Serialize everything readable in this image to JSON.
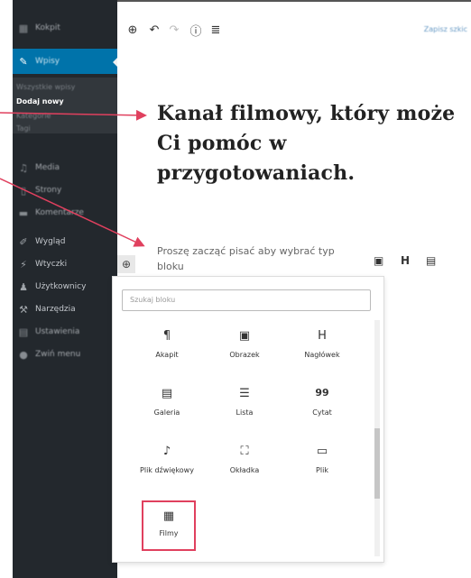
{
  "sidebar": {
    "items": [
      {
        "label": "Kokpit",
        "icon": "dashboard-icon"
      },
      {
        "label": "Wpisy",
        "icon": "pin-icon"
      },
      {
        "label": "Media",
        "icon": "media-icon"
      },
      {
        "label": "Strony",
        "icon": "page-icon"
      },
      {
        "label": "Komentarze",
        "icon": "comment-icon"
      },
      {
        "label": "Wygląd",
        "icon": "brush-icon"
      },
      {
        "label": "Wtyczki",
        "icon": "plugin-icon"
      },
      {
        "label": "Użytkownicy",
        "icon": "users-icon"
      },
      {
        "label": "Narzędzia",
        "icon": "wrench-icon"
      },
      {
        "label": "Ustawienia",
        "icon": "settings-icon"
      },
      {
        "label": "Zwiń menu",
        "icon": "collapse-icon"
      }
    ],
    "submenu": [
      "Wszystkie wpisy",
      "Dodaj nowy",
      "Kategorie",
      "Tagi"
    ]
  },
  "toolbar": {
    "save_draft": "Zapisz szkic"
  },
  "editor": {
    "title": "Kanał filmowy, który może Ci pomóc w przygotowaniach.",
    "placeholder": "Proszę zacząć pisać aby wybrać typ bloku",
    "inline_heading": "H"
  },
  "inserter": {
    "search_placeholder": "Szukaj bloku",
    "blocks": [
      {
        "label": "Akapit",
        "glyph": "¶",
        "icon": "paragraph-icon"
      },
      {
        "label": "Obrazek",
        "glyph": "▣",
        "icon": "image-icon"
      },
      {
        "label": "Nagłówek",
        "glyph": "H",
        "icon": "heading-icon"
      },
      {
        "label": "Galeria",
        "glyph": "▤",
        "icon": "gallery-icon"
      },
      {
        "label": "Lista",
        "glyph": "☰",
        "icon": "list-icon"
      },
      {
        "label": "Cytat",
        "glyph": "99",
        "icon": "quote-icon"
      },
      {
        "label": "Plik dźwiękowy",
        "glyph": "♪",
        "icon": "audio-icon"
      },
      {
        "label": "Okładka",
        "glyph": "⛶",
        "icon": "cover-icon"
      },
      {
        "label": "Plik",
        "glyph": "▭",
        "icon": "file-icon"
      },
      {
        "label": "Filmy",
        "glyph": "▦",
        "icon": "video-icon"
      }
    ]
  },
  "colors": {
    "sidebar_bg": "#23282d",
    "active_blue": "#0073aa",
    "annotation_red": "#e0405e"
  }
}
